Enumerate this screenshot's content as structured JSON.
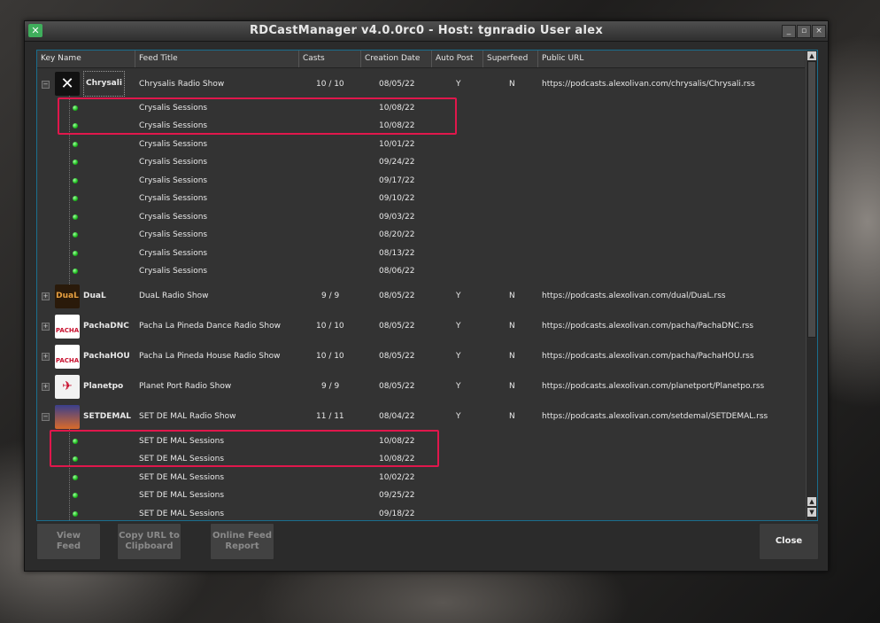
{
  "window": {
    "title": "RDCastManager v4.0.0rc0 - Host: tgnradio User alex",
    "controls": [
      "minimize",
      "maximize",
      "close"
    ]
  },
  "columns": [
    "Key Name",
    "Feed Title",
    "Casts",
    "Creation Date",
    "Auto Post",
    "Superfeed",
    "Public URL"
  ],
  "feeds": [
    {
      "key": "Chrysali",
      "title": "Chrysalis Radio Show",
      "casts": "10 / 10",
      "date": "08/05/22",
      "auto_post": "Y",
      "superfeed": "N",
      "url": "https://podcasts.alexolivan.com/chrysalis/Chrysali.rss",
      "expanded": true,
      "logo": "chrysalis-logo"
    },
    {
      "key": "DuaL",
      "title": "DuaL Radio Show",
      "casts": "9 / 9",
      "date": "08/05/22",
      "auto_post": "Y",
      "superfeed": "N",
      "url": "https://podcasts.alexolivan.com/dual/DuaL.rss",
      "expanded": false,
      "logo": "dual-logo"
    },
    {
      "key": "PachaDNC",
      "title": "Pacha La Pineda Dance Radio Show",
      "casts": "10 / 10",
      "date": "08/05/22",
      "auto_post": "Y",
      "superfeed": "N",
      "url": "https://podcasts.alexolivan.com/pacha/PachaDNC.rss",
      "expanded": false,
      "logo": "pacha-logo"
    },
    {
      "key": "PachaHOU",
      "title": "Pacha La Pineda House Radio Show",
      "casts": "10 / 10",
      "date": "08/05/22",
      "auto_post": "Y",
      "superfeed": "N",
      "url": "https://podcasts.alexolivan.com/pacha/PachaHOU.rss",
      "expanded": false,
      "logo": "pacha-logo"
    },
    {
      "key": "Planetpo",
      "title": "Planet Port Radio Show",
      "casts": "9 / 9",
      "date": "08/05/22",
      "auto_post": "Y",
      "superfeed": "N",
      "url": "https://podcasts.alexolivan.com/planetport/Planetpo.rss",
      "expanded": false,
      "logo": "planetport-logo"
    },
    {
      "key": "SETDEMAL",
      "title": "SET DE MAL Radio Show",
      "casts": "11 / 11",
      "date": "08/04/22",
      "auto_post": "Y",
      "superfeed": "N",
      "url": "https://podcasts.alexolivan.com/setdemal/SETDEMAL.rss",
      "expanded": true,
      "logo": "setdemal-logo"
    }
  ],
  "chrysalis_casts": [
    {
      "title": "Crysalis Sessions",
      "date": "10/08/22"
    },
    {
      "title": "Crysalis Sessions",
      "date": "10/08/22"
    },
    {
      "title": "Crysalis Sessions",
      "date": "10/01/22"
    },
    {
      "title": "Crysalis Sessions",
      "date": "09/24/22"
    },
    {
      "title": "Crysalis Sessions",
      "date": "09/17/22"
    },
    {
      "title": "Crysalis Sessions",
      "date": "09/10/22"
    },
    {
      "title": "Crysalis Sessions",
      "date": "09/03/22"
    },
    {
      "title": "Crysalis Sessions",
      "date": "08/20/22"
    },
    {
      "title": "Crysalis Sessions",
      "date": "08/13/22"
    },
    {
      "title": "Crysalis Sessions",
      "date": "08/06/22"
    }
  ],
  "setdemal_casts": [
    {
      "title": "SET DE MAL Sessions",
      "date": "10/08/22"
    },
    {
      "title": "SET DE MAL Sessions",
      "date": "10/08/22"
    },
    {
      "title": "SET DE MAL Sessions",
      "date": "10/02/22"
    },
    {
      "title": "SET DE MAL Sessions",
      "date": "09/25/22"
    },
    {
      "title": "SET DE MAL Sessions",
      "date": "09/18/22"
    }
  ],
  "logo_text": {
    "dual": "DuaL",
    "pacha": "PACHA"
  },
  "buttons": {
    "view_feed": "View\nFeed",
    "copy_url": "Copy URL to\nClipboard",
    "online_report": "Online Feed\nReport",
    "close": "Close"
  },
  "colors": {
    "highlight": "#e0174c",
    "cast_icon": "#1dbb1d",
    "accent_border": "#1a6e8e"
  }
}
